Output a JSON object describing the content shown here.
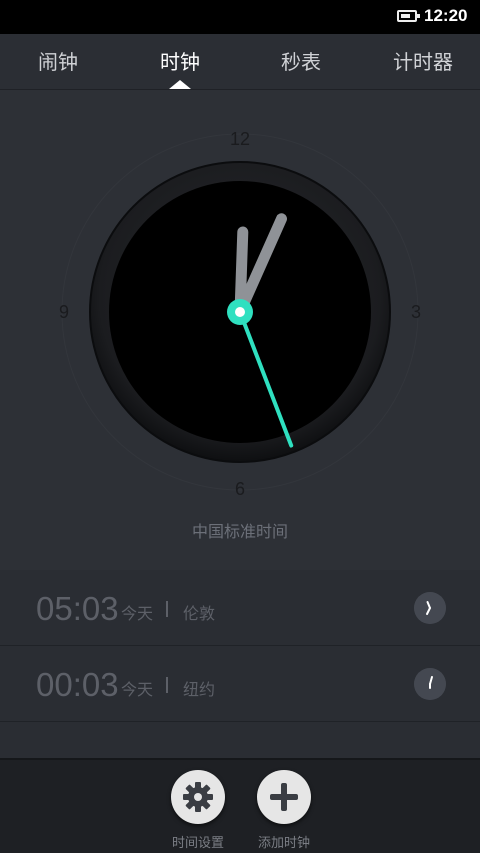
{
  "status_bar": {
    "time": "12:20"
  },
  "tabs": [
    {
      "label": "闹钟"
    },
    {
      "label": "时钟"
    },
    {
      "label": "秒表"
    },
    {
      "label": "计时器"
    }
  ],
  "active_tab": "时钟",
  "clock": {
    "numerals": {
      "twelve": "12",
      "three": "3",
      "six": "6",
      "nine": "9"
    },
    "timezone_label": "中国标准时间",
    "accent_color": "#2fe0c0",
    "hour_value": 12,
    "minute_value": 4,
    "second_value": 26.5
  },
  "world_clocks": [
    {
      "time": "05:03",
      "day": "今天",
      "city": "伦敦"
    },
    {
      "time": "00:03",
      "day": "今天",
      "city": "纽约"
    }
  ],
  "bottom_actions": [
    {
      "label": "时间设置",
      "icon": "gear-icon"
    },
    {
      "label": "添加时钟",
      "icon": "plus-icon"
    }
  ]
}
